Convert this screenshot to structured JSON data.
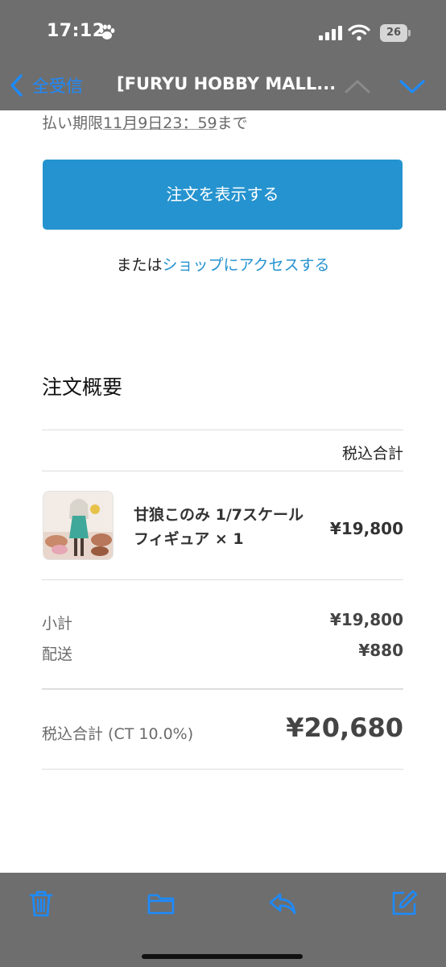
{
  "status_bar": {
    "time": "17:12",
    "battery": "26",
    "icons": [
      "paw-icon",
      "signal-icon",
      "wifi-icon",
      "battery-icon"
    ]
  },
  "nav": {
    "back_label": "全受信",
    "title": "[FURYU HOBBY MALL...",
    "icons": [
      "chevron-left-icon",
      "chevron-up-icon",
      "chevron-down-icon"
    ]
  },
  "email": {
    "due_prefix": "払い期限",
    "due_date": "11月9日23：59",
    "due_suffix": "まで",
    "view_order_button": "注文を表示する",
    "shop_prefix": "または",
    "shop_link": "ショップにアクセスする",
    "summary_title": "注文概要",
    "column_header": "税込合計",
    "item": {
      "name": "甘狼このみ 1/7スケールフィギュア × 1",
      "price": "¥19,800"
    },
    "subtotal_label": "小計",
    "subtotal_value": "¥19,800",
    "shipping_label": "配送",
    "shipping_value": "¥880",
    "total_label": "税込合計 (CT 10.0%)",
    "total_value": "¥20,680"
  },
  "toolbar": {
    "icons": [
      "trash-icon",
      "folder-icon",
      "reply-icon",
      "compose-icon"
    ]
  },
  "colors": {
    "accent": "#1c8bff",
    "button": "#2593cf",
    "bars": "#6e6e6e"
  }
}
